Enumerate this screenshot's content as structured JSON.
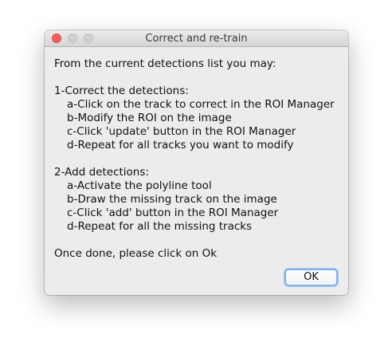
{
  "window": {
    "title": "Correct and re-train"
  },
  "icons": {
    "close": "close-window-icon",
    "minimize": "minimize-window-icon",
    "maximize": "maximize-window-icon"
  },
  "colors": {
    "close": "#fc605c",
    "focus_ring": "#7fb2ee",
    "window_bg": "#ececec"
  },
  "message": {
    "intro": "From the current detections list you may:",
    "section1": {
      "heading": "1-Correct the detections:",
      "steps": [
        "a-Click on the track to correct in the ROI Manager",
        "b-Modify the ROI on the image",
        "c-Click 'update' button in the ROI Manager",
        "d-Repeat for all tracks you want to modify"
      ]
    },
    "section2": {
      "heading": "2-Add detections:",
      "steps": [
        "a-Activate the polyline tool",
        "b-Draw the missing track on the image",
        "c-Click 'add' button in the ROI Manager",
        "d-Repeat for all the missing tracks"
      ]
    },
    "footer": "Once done, please click on Ok"
  },
  "buttons": {
    "ok_label": "OK"
  }
}
